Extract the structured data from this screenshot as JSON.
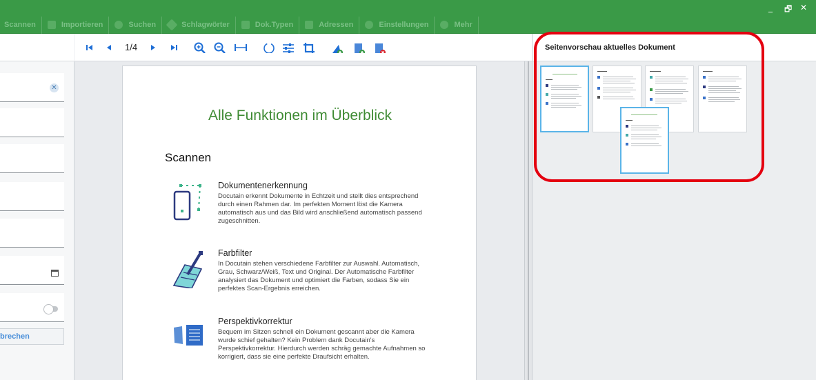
{
  "window": {
    "controls": [
      "_",
      "🗗",
      "✕"
    ]
  },
  "menu": {
    "items": [
      {
        "label": "Scannen",
        "icon": "scan-icon"
      },
      {
        "label": "Importieren",
        "icon": "import-icon"
      },
      {
        "label": "Suchen",
        "icon": "search-icon"
      },
      {
        "label": "Schlagwörter",
        "icon": "tag-icon"
      },
      {
        "label": "Dok.Typen",
        "icon": "doctype-icon"
      },
      {
        "label": "Adressen",
        "icon": "address-icon"
      },
      {
        "label": "Einstellungen",
        "icon": "gear-icon"
      },
      {
        "label": "Mehr",
        "icon": "info-icon"
      }
    ]
  },
  "form": {
    "clear_symbol": "✕",
    "cancel_label": "brechen"
  },
  "viewer": {
    "page_indicator": "1/4",
    "icons": [
      "first-page-icon",
      "prev-page-icon",
      "next-page-icon",
      "last-page-icon",
      "zoom-in-icon",
      "zoom-out-icon",
      "fit-width-icon",
      "rotate-icon",
      "adjust-icon",
      "crop-icon",
      "add-page-left-icon",
      "add-page-icon",
      "delete-page-icon"
    ]
  },
  "document": {
    "title": "Alle Funktionen im Überblick",
    "section": "Scannen",
    "features": [
      {
        "heading": "Dokumentenerkennung",
        "text": "Docutain erkennt Dokumente in Echtzeit und stellt dies entsprechend durch einen Rahmen dar. Im perfekten Moment löst die Kamera automatisch aus und das Bild wird anschließend automatisch passend zugeschnitten."
      },
      {
        "heading": "Farbfilter",
        "text": "In Docutain stehen verschiedene Farbfilter zur Auswahl. Automatisch, Grau, Schwarz/Weiß, Text und Original. Der Automatische Farbfilter analysiert das Dokument und optimiert die Farben, sodass Sie ein perfektes Scan-Ergebnis erreichen."
      },
      {
        "heading": "Perspektivkorrektur",
        "text": "Bequem im Sitzen schnell ein Dokument gescannt aber die Kamera wurde schief gehalten? Kein Problem dank Docutain's Perspektivkorrektur. Hierdurch werden schräg gemachte Aufnahmen so korrigiert, dass sie eine perfekte Draufsicht erhalten."
      }
    ]
  },
  "preview": {
    "title": "Seitenvorschau aktuelles Dokument",
    "thumbnails": 4,
    "selected": 1,
    "highlight_color": "#e4000f"
  },
  "colors": {
    "brand_green": "#3a9a47",
    "title_green": "#3f8b34",
    "accent_blue": "#1f6fd6"
  }
}
